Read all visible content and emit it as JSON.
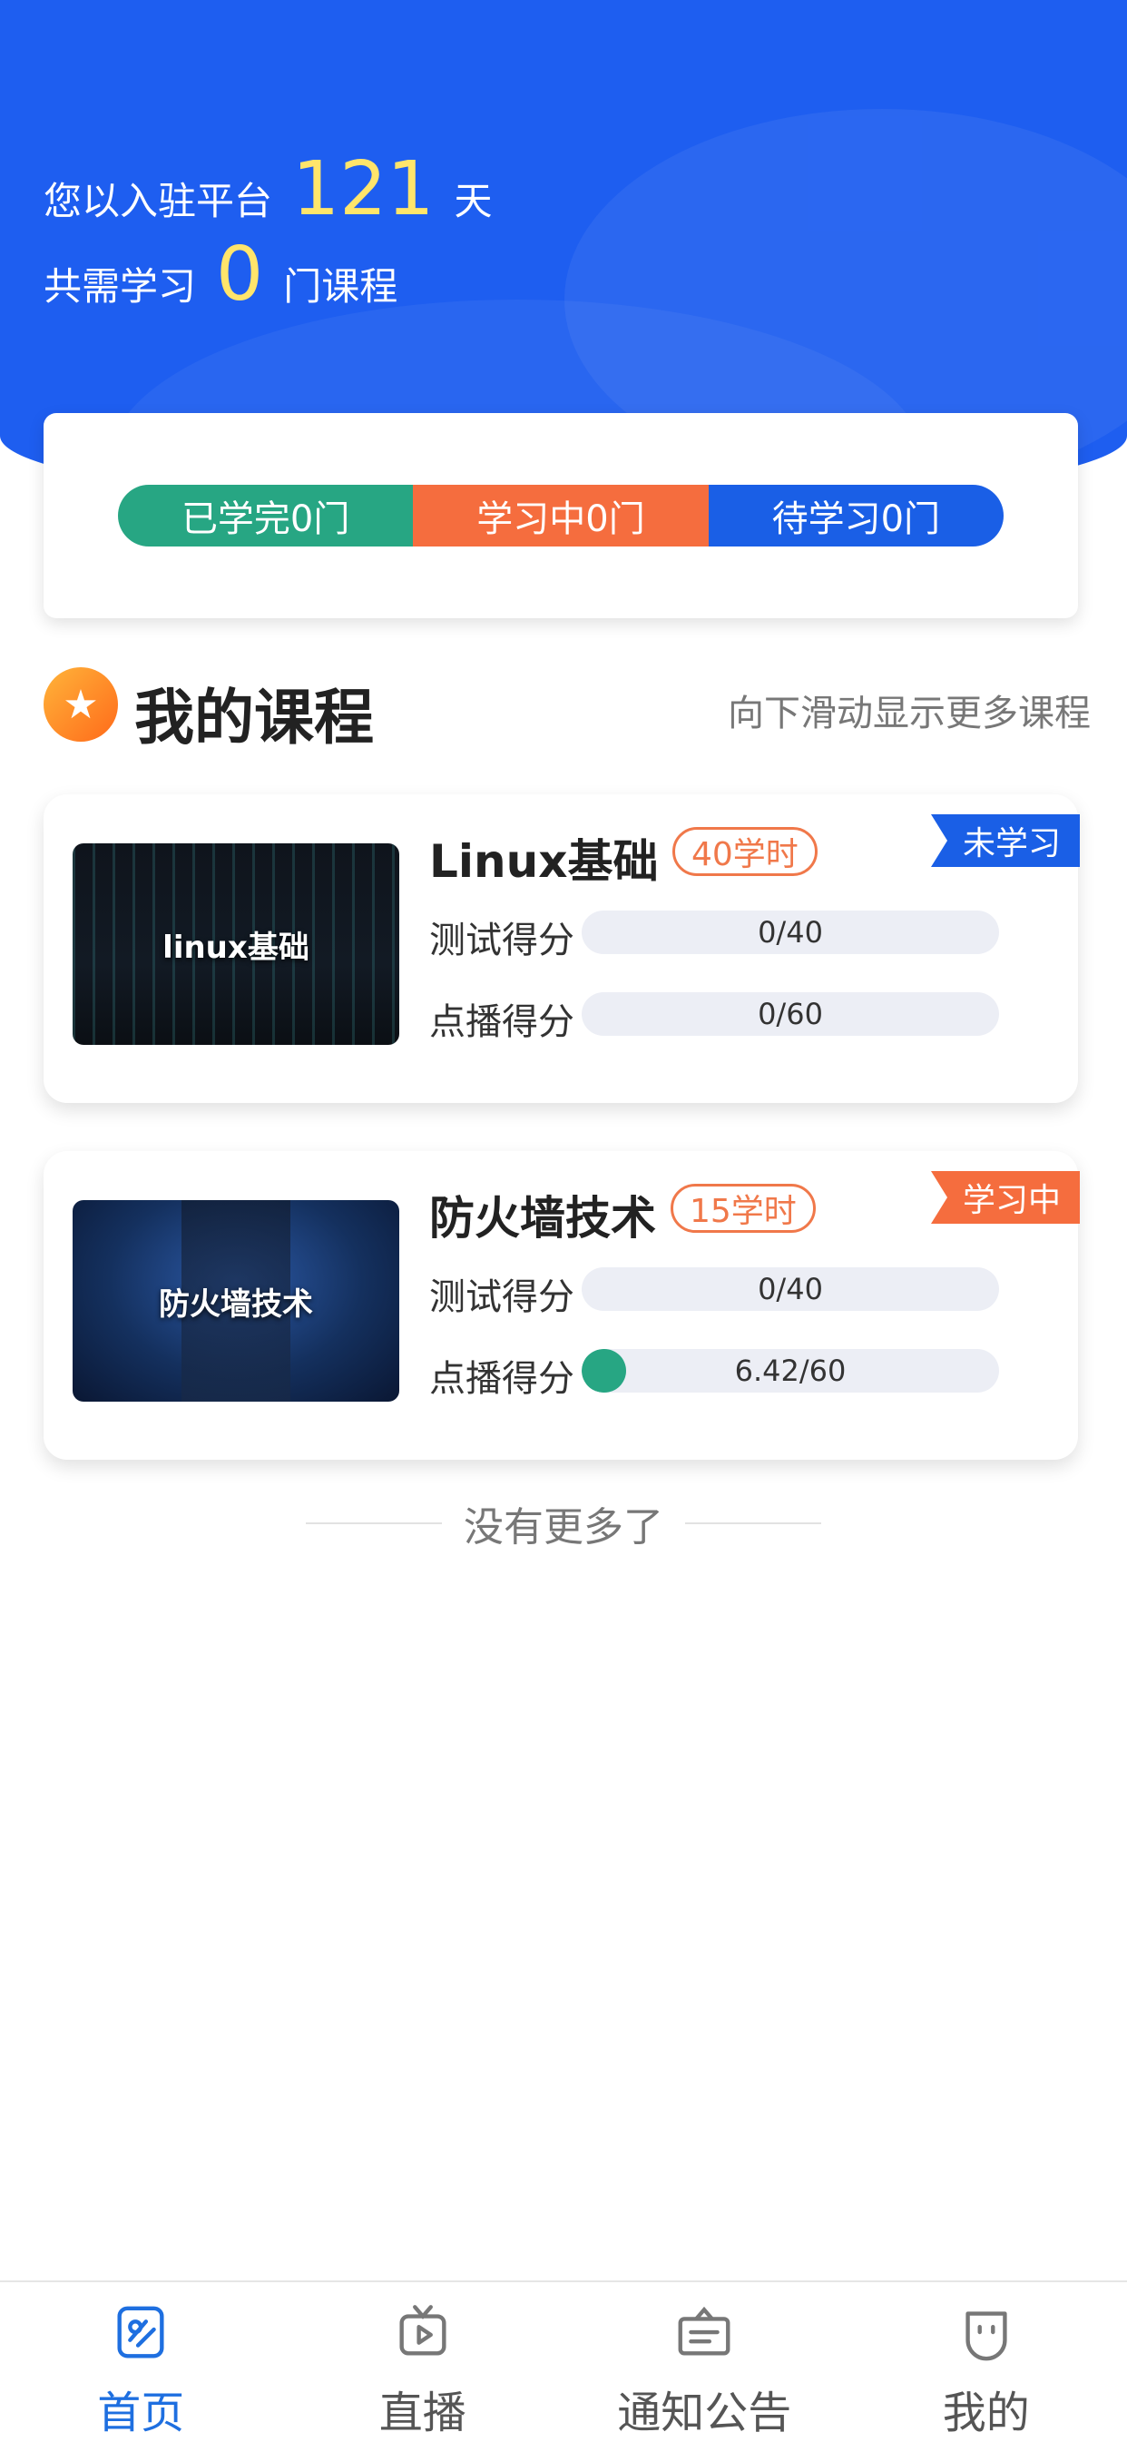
{
  "header": {
    "days_prefix": "您以入驻平台",
    "days_value": "121",
    "days_suffix": "天",
    "courses_prefix": "共需学习",
    "courses_value": "0",
    "courses_suffix": "门课程"
  },
  "summary": {
    "completed_label": "已学完0门",
    "in_progress_label": "学习中0门",
    "pending_label": "待学习0门",
    "colors": {
      "completed": "#27a683",
      "in_progress": "#f56d3e",
      "pending": "#1a5fe6"
    }
  },
  "section": {
    "icon": "star-icon",
    "title": "我的课程",
    "hint": "向下滑动显示更多课程"
  },
  "courses": [
    {
      "title": "Linux基础",
      "thumbnail_text": "linux基础",
      "hours": "40学时",
      "status": "未学习",
      "status_color": "#1a5fe6",
      "test_label": "测试得分",
      "test_score": "0/40",
      "test_fraction": 0,
      "vod_label": "点播得分",
      "vod_score": "0/60",
      "vod_fraction": 0
    },
    {
      "title": "防火墙技术",
      "thumbnail_text": "防火墙技术",
      "hours": "15学时",
      "status": "学习中",
      "status_color": "#f56d3e",
      "test_label": "测试得分",
      "test_score": "0/40",
      "test_fraction": 0,
      "vod_label": "点播得分",
      "vod_score": "6.42/60",
      "vod_fraction": 0.107
    }
  ],
  "footer_note": "没有更多了",
  "tabbar": {
    "items": [
      {
        "label": "首页",
        "icon": "home-icon",
        "active": true
      },
      {
        "label": "直播",
        "icon": "tv-play-icon",
        "active": false
      },
      {
        "label": "通知公告",
        "icon": "notice-board-icon",
        "active": false
      },
      {
        "label": "我的",
        "icon": "profile-icon",
        "active": false
      }
    ],
    "active_color": "#1e6fe0"
  }
}
